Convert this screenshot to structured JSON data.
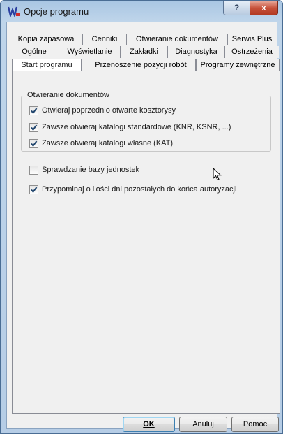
{
  "window": {
    "title": "Opcje programu",
    "help_label": "?",
    "close_label": "x"
  },
  "tabs": {
    "row1": [
      "Kopia zapasowa",
      "Cenniki",
      "Otwieranie dokumentów",
      "Serwis Plus"
    ],
    "row2": [
      "Ogólne",
      "Wyświetlanie",
      "Zakładki",
      "Diagnostyka",
      "Ostrzeżenia"
    ],
    "row3": [
      "Start programu",
      "Przenoszenie pozycji robót",
      "Programy zewnętrzne"
    ],
    "active": "Start programu"
  },
  "group": {
    "title": "Otwieranie dokumentów",
    "options": [
      {
        "label": "Otwieraj poprzednio otwarte kosztorysy",
        "checked": true
      },
      {
        "label": "Zawsze otwieraj katalogi standardowe (KNR, KSNR, ...)",
        "checked": true
      },
      {
        "label": "Zawsze otwieraj katalogi własne (KAT)",
        "checked": true
      }
    ]
  },
  "options": [
    {
      "label": "Sprawdzanie bazy jednostek",
      "checked": false
    },
    {
      "label": "Przypominaj o ilości dni pozostałych do końca autoryzacji",
      "checked": true
    }
  ],
  "buttons": {
    "ok": "OK",
    "cancel": "Anuluj",
    "help": "Pomoc"
  },
  "colors": {
    "titlebar": "#b6cde6",
    "close": "#c7513a",
    "accent": "#3c7fb1"
  }
}
